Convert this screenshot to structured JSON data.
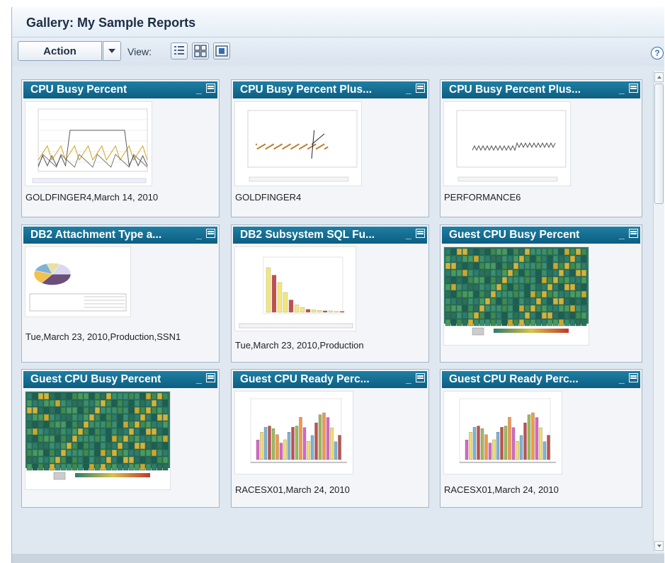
{
  "window": {
    "title": "Gallery: My Sample Reports"
  },
  "toolbar": {
    "action_label": "Action",
    "view_label": "View:",
    "view_options": [
      "list-view-icon",
      "tile-view-icon",
      "thumbnail-view-icon"
    ]
  },
  "colors": {
    "card_header": "#0f6a90",
    "panel_bg": "#dfe8f1"
  },
  "cards": [
    {
      "title": "CPU Busy Percent",
      "caption": "GOLDFINGER4,March 14, 2010",
      "thumb": "line"
    },
    {
      "title": "CPU Busy Percent Plus...",
      "caption": "GOLDFINGER4",
      "thumb": "scatter"
    },
    {
      "title": "CPU Busy Percent Plus...",
      "caption": "PERFORMANCE6",
      "thumb": "wave"
    },
    {
      "title": "DB2 Attachment Type a...",
      "caption": "Tue,March 23, 2010,Production,SSN1",
      "thumb": "pie"
    },
    {
      "title": "DB2 Subsystem SQL Fu...",
      "caption": "Tue,March 23, 2010,Production",
      "thumb": "bar3d"
    },
    {
      "title": "Guest CPU Busy Percent",
      "caption": "",
      "thumb": "treemap"
    },
    {
      "title": "Guest CPU Busy Percent",
      "caption": "",
      "thumb": "treemap"
    },
    {
      "title": "Guest CPU Ready Perc...",
      "caption": "RACESX01,March 24, 2010",
      "thumb": "bar3dmulti"
    },
    {
      "title": "Guest CPU Ready Perc...",
      "caption": "RACESX01,March 24, 2010",
      "thumb": "bar3dmulti"
    }
  ]
}
